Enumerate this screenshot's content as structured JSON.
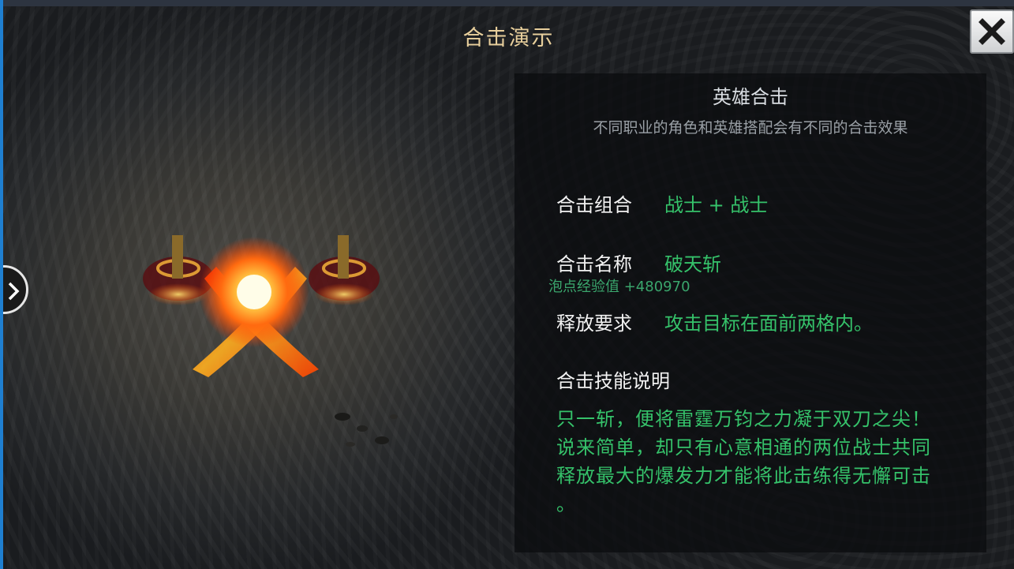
{
  "window": {
    "title": "合击演示",
    "close_icon": "close-icon",
    "side_toggle_icon": "chevron-right-icon"
  },
  "panel": {
    "title": "英雄合击",
    "subtitle": "不同职业的角色和英雄搭配会有不同的合击效果",
    "combo_label": "合击组合",
    "combo_value": "战士 + 战士",
    "name_label": "合击名称",
    "name_value": "破天斩",
    "exp_text": "泡点经验值 +480970",
    "requirement_label": "释放要求",
    "requirement_value": "攻击目标在面前两格内。",
    "skill_desc_label": "合击技能说明",
    "skill_desc_lines": [
      "只一斩，便将雷霆万钧之力凝于双刀之尖！",
      "说来简单，却只有心意相通的两位战士共同",
      "释放最大的爆发力才能将此击练得无懈可击",
      "。"
    ]
  },
  "colors": {
    "title": "#e8cf9c",
    "value_green": "#35c26a",
    "label_white": "#f2f2f2"
  }
}
